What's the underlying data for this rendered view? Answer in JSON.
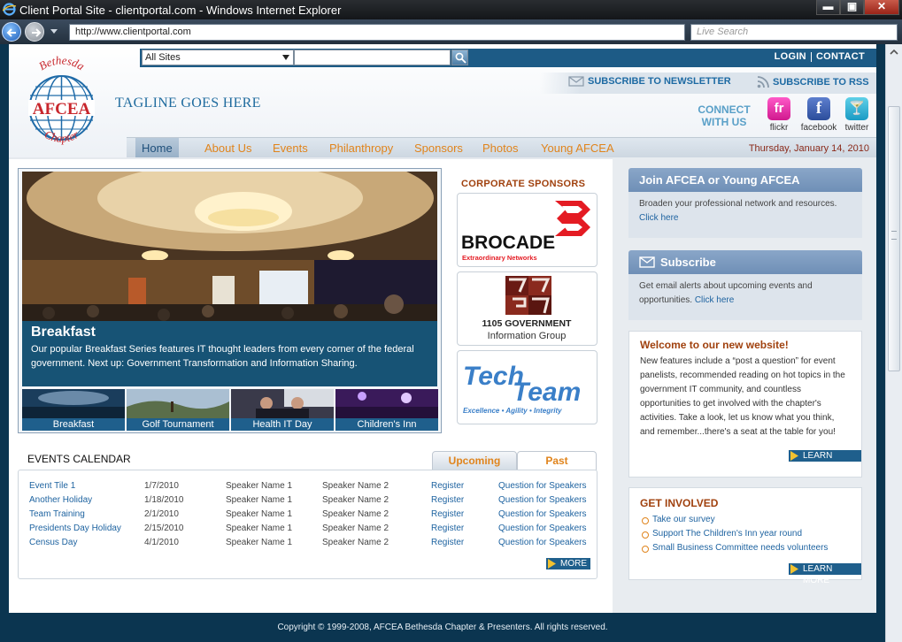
{
  "window": {
    "title": "Client Portal Site - clientportal.com - Windows Internet Explorer",
    "min": "▬",
    "max": "▣",
    "close": "✕"
  },
  "browser": {
    "address": "http://www.clientportal.com",
    "search_placeholder": "Live Search"
  },
  "header": {
    "site_select": "All Sites",
    "login": "LOGIN",
    "contact": "CONTACT",
    "tagline": "TAGLINE GOES HERE",
    "newsletter": "SUBSCRIBE TO NEWSLETTER",
    "rss": "SUBSCRIBE TO RSS",
    "connect": "CONNECT WITH US",
    "social": [
      {
        "label": "flickr",
        "glyph": "fr"
      },
      {
        "label": "facebook",
        "glyph": "f"
      },
      {
        "label": "twitter",
        "glyph": "🍸"
      }
    ],
    "logo": {
      "top": "Bethesda",
      "middle": "AFCEA",
      "bottom": "Chapter"
    }
  },
  "nav": {
    "items": [
      "Home",
      "About Us",
      "Events",
      "Philanthropy",
      "Sponsors",
      "Photos",
      "Young AFCEA"
    ],
    "date": "Thursday, January 14, 2010"
  },
  "hero": {
    "title": "Breakfast",
    "text": "Our popular Breakfast Series features IT thought leaders from every corner of the federal government. Next up: Government Transformation and Information Sharing.",
    "thumbs": [
      "Breakfast",
      "Golf Tournament",
      "Health IT Day",
      "Children's Inn"
    ]
  },
  "sponsors": {
    "heading": "CORPORATE SPONSORS",
    "brocade": {
      "name": "BROCADE",
      "tag": "Extraordinary Networks"
    },
    "gov": {
      "mark": "1105",
      "line1": "1105 GOVERNMENT",
      "line2": "Information Group"
    },
    "tech": {
      "name1": "Tech",
      "name2": "Team",
      "tag": "Excellence • Agility • Integrity"
    }
  },
  "events": {
    "title": "EVENTS CALENDAR",
    "tabs": [
      "Upcoming",
      "Past"
    ],
    "rows": [
      [
        "Event Tile 1",
        "1/7/2010",
        "Speaker Name 1",
        "Speaker Name 2",
        "Register",
        "Question for Speakers"
      ],
      [
        "Another Holiday",
        "1/18/2010",
        "Speaker Name 1",
        "Speaker Name 2",
        "Register",
        "Question for Speakers"
      ],
      [
        "Team Training",
        "2/1/2010",
        "Speaker Name 1",
        "Speaker Name 2",
        "Register",
        "Question for Speakers"
      ],
      [
        "Presidents Day Holiday",
        "2/15/2010",
        "Speaker Name 1",
        "Speaker Name 2",
        "Register",
        "Question for Speakers"
      ],
      [
        "Census Day",
        "4/1/2010",
        "Speaker Name 1",
        "Speaker Name 2",
        "Register",
        "Question for Speakers"
      ]
    ],
    "more": "MORE"
  },
  "join": {
    "title": "Join AFCEA or Young AFCEA",
    "text": "Broaden your professional network and resources.",
    "link": "Click here"
  },
  "subscribe": {
    "title": "Subscribe",
    "text": "Get email alerts about upcoming events and opportunities.",
    "link": "Click here"
  },
  "welcome": {
    "title": "Welcome to our new website!",
    "text": "New features include a “post a question” for event panelists, recommended reading on hot topics in the government IT community, and countless opportunities to get involved with the chapter's activities. Take a look, let us know what you think, and remember...there's a seat at the table for you!",
    "more": "LEARN MORE"
  },
  "involved": {
    "title": "GET INVOLVED",
    "items": [
      "Take our survey",
      "Support The Children's Inn year round",
      "Small Business Committee needs volunteers"
    ],
    "more": "LEARN MORE"
  },
  "footer": {
    "text": "Copyright © 1999-2008, AFCEA Bethesda Chapter & Presenters. All rights reserved."
  },
  "colors": {
    "brand_blue": "#1d5b86",
    "accent_orange": "#e0841c",
    "heading_rust": "#a0410e"
  }
}
